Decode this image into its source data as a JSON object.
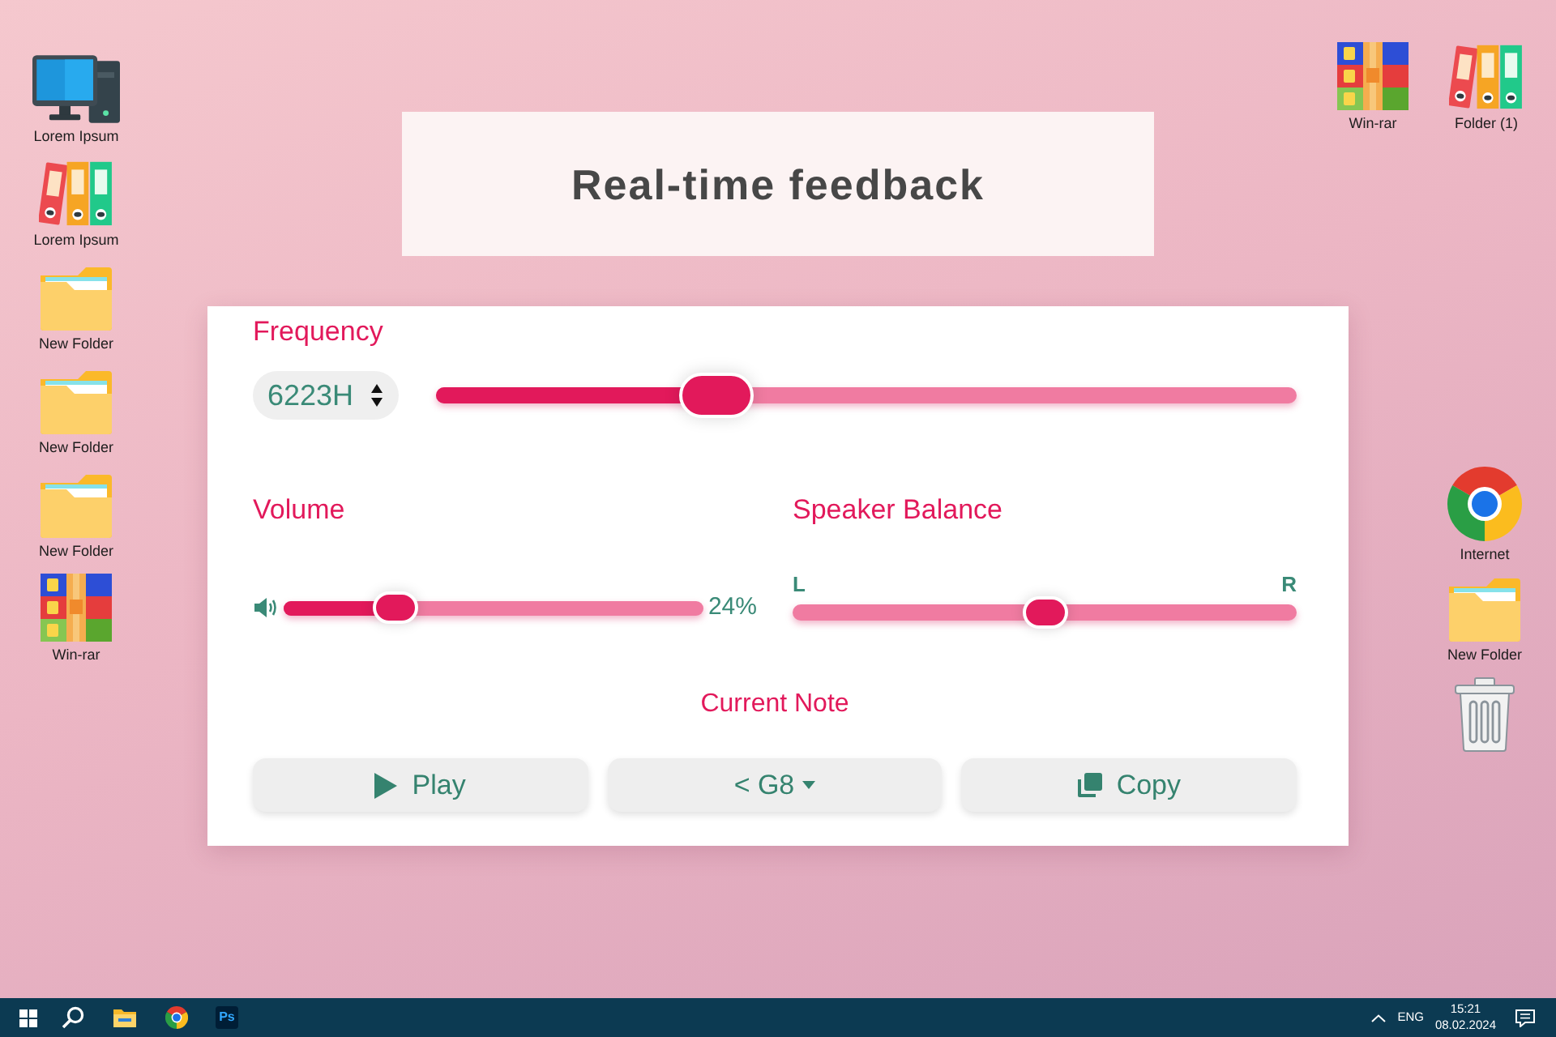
{
  "desktop": {
    "left_icons": [
      {
        "kind": "computer",
        "label": "Lorem Ipsum"
      },
      {
        "kind": "binders",
        "label": "Lorem Ipsum"
      },
      {
        "kind": "folder",
        "label": "New Folder"
      },
      {
        "kind": "folder",
        "label": "New Folder"
      },
      {
        "kind": "folder",
        "label": "New Folder"
      },
      {
        "kind": "archive",
        "label": "Win-rar"
      }
    ],
    "top_right_icons": [
      {
        "kind": "archive",
        "label": "Win-rar"
      },
      {
        "kind": "binders",
        "label": "Folder (1)"
      }
    ],
    "right_icons": [
      {
        "kind": "browser",
        "label": "Internet"
      },
      {
        "kind": "folder",
        "label": "New Folder"
      },
      {
        "kind": "trash"
      }
    ]
  },
  "header": {
    "title": "Real-time feedback"
  },
  "panel": {
    "frequency": {
      "label": "Frequency",
      "value": "6223H",
      "level": 0.31
    },
    "volume": {
      "label": "Volume",
      "level": 0.24,
      "reading": "24%"
    },
    "balance": {
      "label": "Speaker Balance",
      "left_label": "L",
      "right_label": "R",
      "level": 0.5
    },
    "note": {
      "label": "Current Note",
      "buttons": [
        {
          "kind": "play",
          "label": "Play"
        },
        {
          "kind": "dropdown",
          "label": "< G8"
        },
        {
          "kind": "copy",
          "label": "Copy"
        }
      ]
    }
  },
  "taskbar": {
    "apps": [
      {
        "kind": "start"
      },
      {
        "kind": "search"
      },
      {
        "kind": "folder"
      },
      {
        "kind": "browser"
      },
      {
        "kind": "photoshop",
        "text": "Ps"
      }
    ],
    "tray": {
      "language": "ENG",
      "time": "15:21",
      "date": "08.02.2024"
    }
  }
}
